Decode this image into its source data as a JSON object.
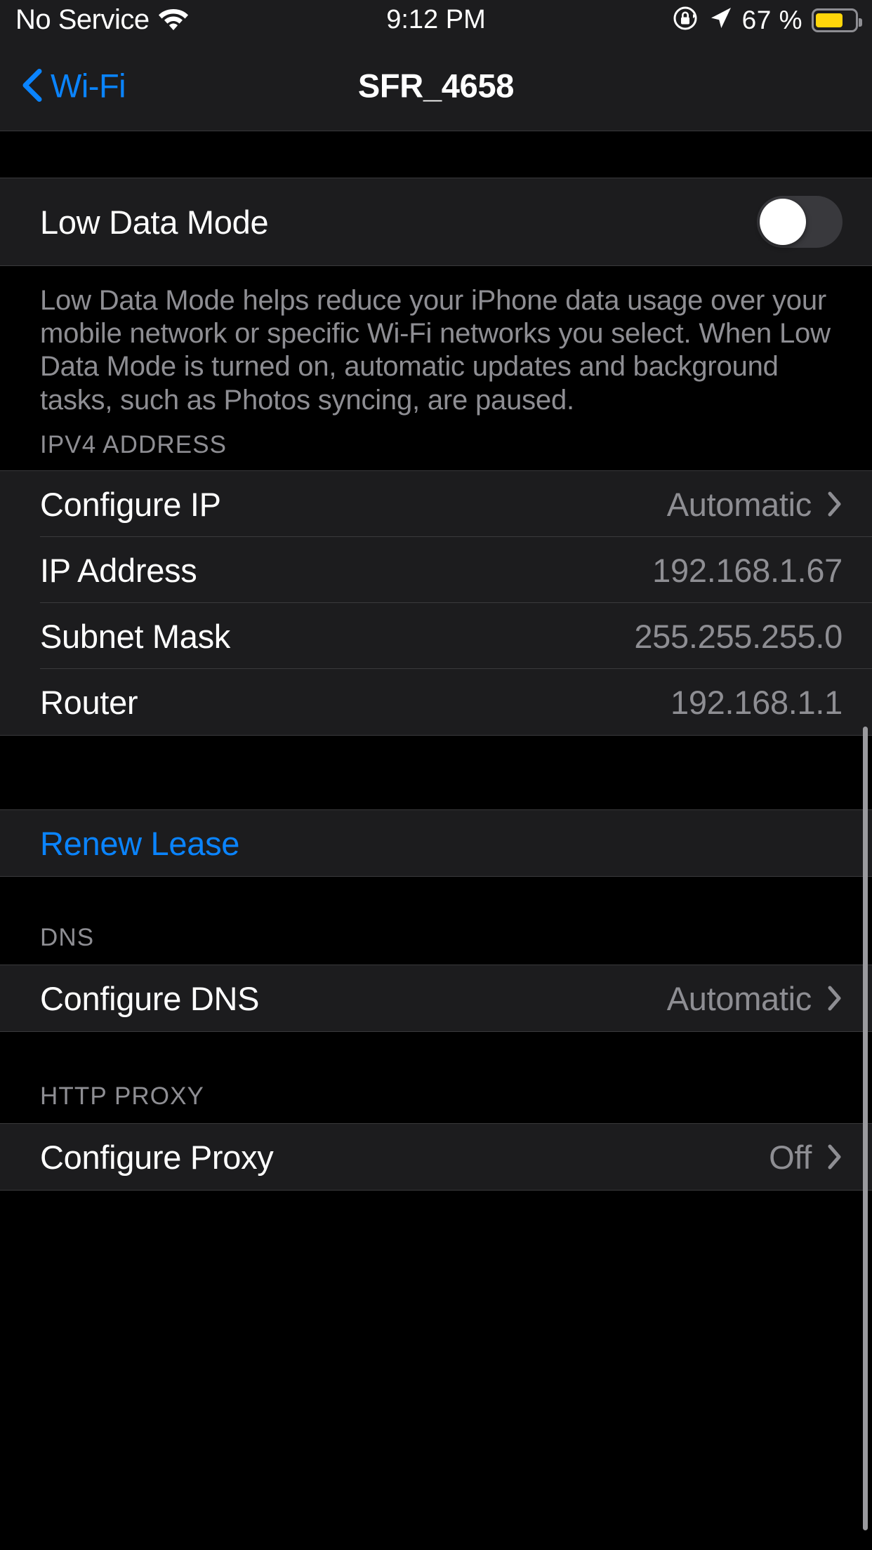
{
  "status_bar": {
    "carrier": "No Service",
    "wifi_icon": "wifi-icon",
    "time": "9:12 PM",
    "rotation_lock_icon": "rotation-lock-icon",
    "location_icon": "location-arrow-icon",
    "battery_percent": "67 %",
    "battery_icon": "battery-icon",
    "battery_color": "#ffd60a"
  },
  "nav": {
    "back_label": "Wi-Fi",
    "back_icon": "chevron-left-icon",
    "title": "SFR_4658",
    "tint_color": "#0a84ff"
  },
  "low_data": {
    "label": "Low Data Mode",
    "toggle_state": "off",
    "footer": "Low Data Mode helps reduce your iPhone data usage over your mobile network or specific Wi-Fi networks you select. When Low Data Mode is turned on, automatic updates and background tasks, such as Photos syncing, are paused."
  },
  "ipv4": {
    "header": "IPV4 ADDRESS",
    "rows": [
      {
        "label": "Configure IP",
        "value": "Automatic",
        "chevron": "chevron-right-icon"
      },
      {
        "label": "IP Address",
        "value": "192.168.1.67",
        "chevron": ""
      },
      {
        "label": "Subnet Mask",
        "value": "255.255.255.0",
        "chevron": ""
      },
      {
        "label": "Router",
        "value": "192.168.1.1",
        "chevron": ""
      }
    ]
  },
  "renew": {
    "label": "Renew Lease"
  },
  "dns": {
    "header": "DNS",
    "rows": [
      {
        "label": "Configure DNS",
        "value": "Automatic",
        "chevron": "chevron-right-icon"
      }
    ]
  },
  "proxy": {
    "header": "HTTP PROXY",
    "rows": [
      {
        "label": "Configure Proxy",
        "value": "Off",
        "chevron": "chevron-right-icon"
      }
    ]
  },
  "scroll": {
    "indicator": "scroll-indicator"
  }
}
